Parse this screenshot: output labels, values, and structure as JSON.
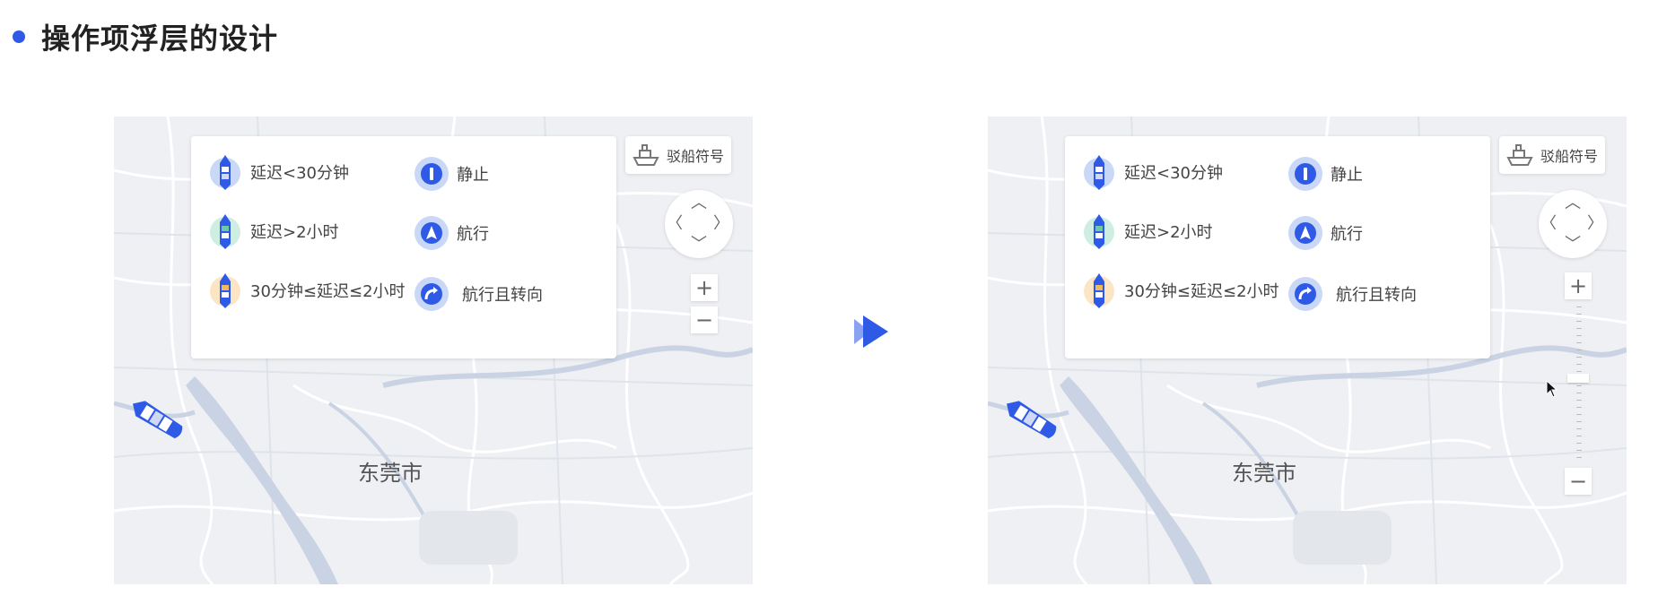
{
  "heading": "操作项浮层的设计",
  "colors": {
    "accent": "#2f5ae6",
    "delay_short": "#c9d8f7",
    "delay_long": "#cfeee2",
    "delay_mid": "#fbe5c4"
  },
  "legend": {
    "delay_items": [
      {
        "label": "延迟<30分钟",
        "icon": "ship-blue-icon"
      },
      {
        "label": "延迟>2小时",
        "icon": "ship-green-icon"
      },
      {
        "label": "30分钟≤延迟≤2小时",
        "icon": "ship-orange-icon"
      }
    ],
    "status_items": [
      {
        "label": "静止",
        "icon": "stationary-icon"
      },
      {
        "label": "航行",
        "icon": "navigation-arrow-icon"
      },
      {
        "label": "航行且转向",
        "icon": "turn-arrow-icon"
      }
    ]
  },
  "ship_symbol_button": "驳船符号",
  "zoom": {
    "plus": "+",
    "minus": "−",
    "slider_level": 0.47
  },
  "city": "东莞市",
  "pan": {
    "up": "︿",
    "down": "﹀",
    "left": "〈",
    "right": "〉"
  }
}
